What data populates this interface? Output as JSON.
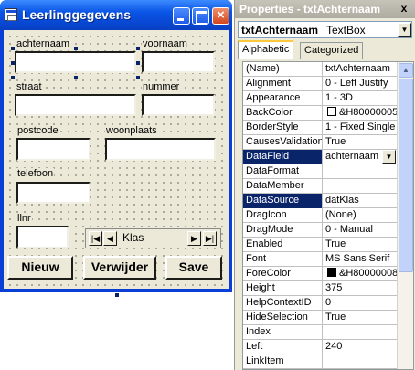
{
  "form_window": {
    "title": "Leerlinggegevens",
    "labels": {
      "achternaam": "achternaam",
      "voornaam": "voornaam",
      "straat": "straat",
      "nummer": "nummer",
      "postcode": "postcode",
      "woonplaats": "woonplaats",
      "telefoon": "telefoon",
      "llnr": "llnr"
    },
    "data_control": {
      "caption": "Klas",
      "first_icon": "first-record-icon",
      "prev_icon": "prev-record-icon",
      "next_icon": "next-record-icon",
      "last_icon": "last-record-icon"
    },
    "buttons": {
      "nieuw": "Nieuw",
      "verwijder": "Verwijder",
      "save": "Save"
    }
  },
  "properties_window": {
    "title": "Properties - txtAchternaam",
    "close_glyph": "x",
    "object_name": "txtAchternaam",
    "object_type": "TextBox",
    "tabs": [
      "Alphabetic",
      "Categorized"
    ],
    "active_tab": "Alphabetic",
    "rows": [
      {
        "name": "(Name)",
        "value": "txtAchternaam"
      },
      {
        "name": "Alignment",
        "value": "0 - Left Justify"
      },
      {
        "name": "Appearance",
        "value": "1 - 3D"
      },
      {
        "name": "BackColor",
        "value": "&H80000005",
        "swatch": "#ffffff"
      },
      {
        "name": "BorderStyle",
        "value": "1 - Fixed Single"
      },
      {
        "name": "CausesValidation",
        "value": "True"
      },
      {
        "name": "DataField",
        "value": "achternaam",
        "selected": true,
        "dropdown": true
      },
      {
        "name": "DataFormat",
        "value": ""
      },
      {
        "name": "DataMember",
        "value": ""
      },
      {
        "name": "DataSource",
        "value": "datKlas",
        "selected": true
      },
      {
        "name": "DragIcon",
        "value": "(None)"
      },
      {
        "name": "DragMode",
        "value": "0 - Manual"
      },
      {
        "name": "Enabled",
        "value": "True"
      },
      {
        "name": "Font",
        "value": "MS Sans Serif"
      },
      {
        "name": "ForeColor",
        "value": "&H80000008",
        "swatch": "#000000"
      },
      {
        "name": "Height",
        "value": "375"
      },
      {
        "name": "HelpContextID",
        "value": "0"
      },
      {
        "name": "HideSelection",
        "value": "True"
      },
      {
        "name": "Index",
        "value": ""
      },
      {
        "name": "Left",
        "value": "240"
      },
      {
        "name": "LinkItem",
        "value": ""
      }
    ]
  },
  "colors": {
    "title_bar": "#0a55e6",
    "selection": "#0a246a",
    "form_background": "#ece9d8"
  }
}
